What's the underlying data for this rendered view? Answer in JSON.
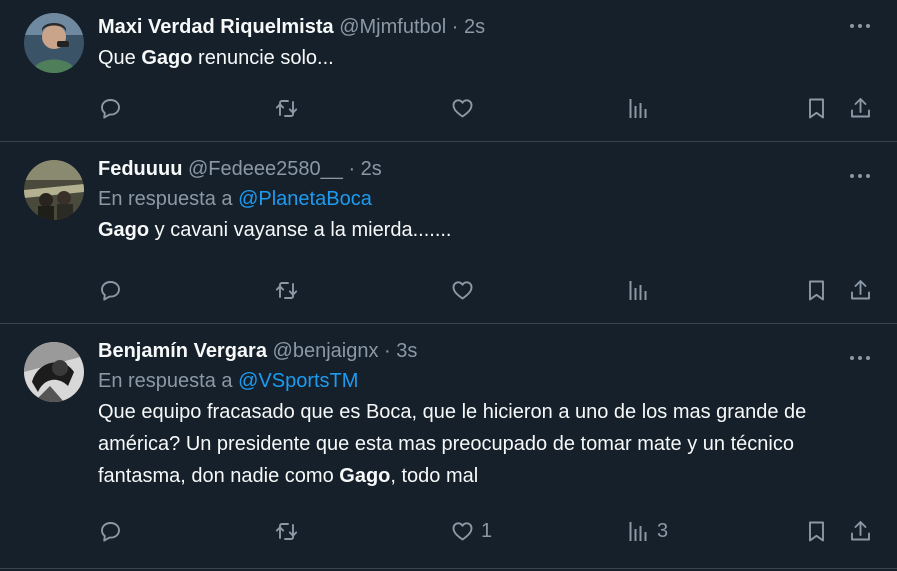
{
  "tweets": [
    {
      "name": "Maxi Verdad Riquelmista",
      "handle": "@Mjmfutbol",
      "separator": "·",
      "time": "2s",
      "reply_prefix": "",
      "reply_to": "",
      "text_parts": [
        "Que ",
        "Gago",
        " renuncie solo..."
      ],
      "like_count": "",
      "view_count": ""
    },
    {
      "name": "Feduuuu",
      "handle": "@Fedeee2580__",
      "separator": "·",
      "time": "2s",
      "reply_prefix": "En respuesta a ",
      "reply_to": "@PlanetaBoca",
      "text_parts": [
        "",
        "Gago",
        " y cavani vayanse a la mierda......."
      ],
      "like_count": "",
      "view_count": ""
    },
    {
      "name": "Benjamín Vergara",
      "handle": "@benjaignx",
      "separator": "·",
      "time": "3s",
      "reply_prefix": "En respuesta a ",
      "reply_to": "@VSportsTM",
      "text_parts": [
        "Que equipo fracasado que es Boca, que le hicieron a uno de los mas grande de américa? Un presidente que esta mas preocupado de tomar mate y un técnico fantasma, don nadie como ",
        "Gago",
        ", todo mal"
      ],
      "like_count": "1",
      "view_count": "3"
    }
  ],
  "colors": {
    "background": "#15202b",
    "divider": "#38444d",
    "text_primary": "#f7f9f9",
    "text_secondary": "#8b98a5",
    "link": "#1d9bf0"
  },
  "icons": [
    "reply-icon",
    "retweet-icon",
    "like-icon",
    "views-icon",
    "bookmark-icon",
    "share-icon",
    "more-icon"
  ]
}
